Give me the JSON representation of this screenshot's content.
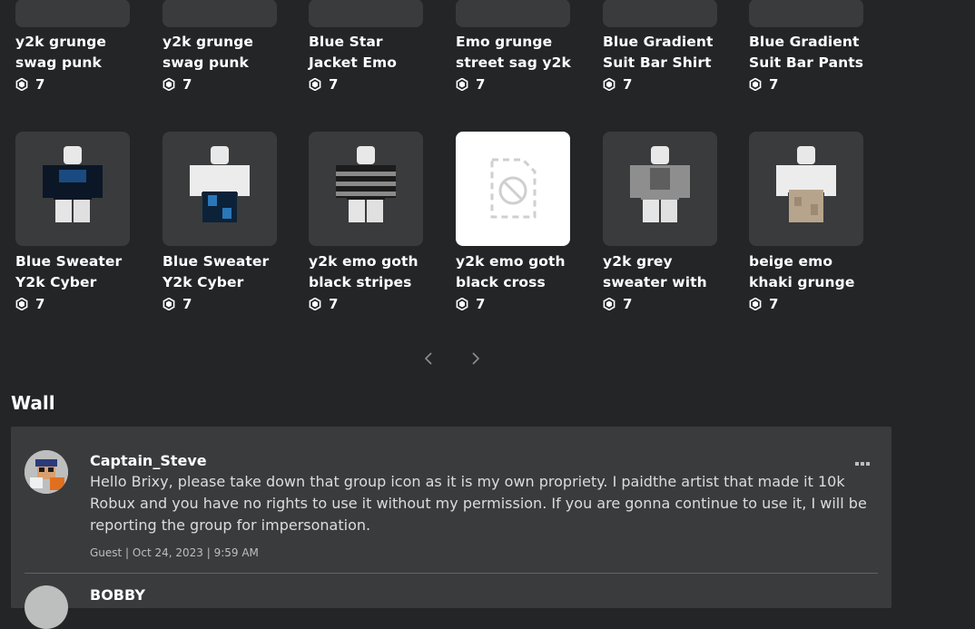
{
  "catalog": {
    "currency_icon": "robux-icon",
    "row1": [
      {
        "name": "y2k grunge\nswag punk",
        "price": "7"
      },
      {
        "name": "y2k grunge\nswag punk",
        "price": "7"
      },
      {
        "name": "Blue Star\nJacket Emo",
        "price": "7"
      },
      {
        "name": "Emo grunge\nstreet sag y2k",
        "price": "7"
      },
      {
        "name": "Blue Gradient\nSuit Bar Shirt",
        "price": "7"
      },
      {
        "name": "Blue Gradient\nSuit Bar Pants",
        "price": "7"
      }
    ],
    "row2": [
      {
        "name": "Blue Sweater\nY2k Cyber",
        "price": "7"
      },
      {
        "name": "Blue Sweater\nY2k Cyber",
        "price": "7"
      },
      {
        "name": "y2k emo goth\nblack stripes",
        "price": "7"
      },
      {
        "name": "y2k emo goth\nblack cross",
        "price": "7"
      },
      {
        "name": "y2k grey\nsweater with",
        "price": "7"
      },
      {
        "name": "beige emo\nkhaki grunge",
        "price": "7"
      }
    ]
  },
  "pager": {
    "prev_icon": "chevron-left-icon",
    "next_icon": "chevron-right-icon"
  },
  "wall": {
    "title": "Wall",
    "posts": [
      {
        "author": "Captain_Steve",
        "body": "Hello Brixy, please take down that group icon as it is my own propriety. I paidthe artist that made it 10k Robux and you have no rights to use it without my permission. If you are gonna continue to use it, I will be reporting the group for impersonation.",
        "meta": "Guest | Oct 24, 2023 | 9:59 AM"
      },
      {
        "author": "BOBBY"
      }
    ]
  },
  "colors": {
    "background": "#232527",
    "card": "#393b3d",
    "text": "#ffffff",
    "muted": "#bdbebe"
  }
}
